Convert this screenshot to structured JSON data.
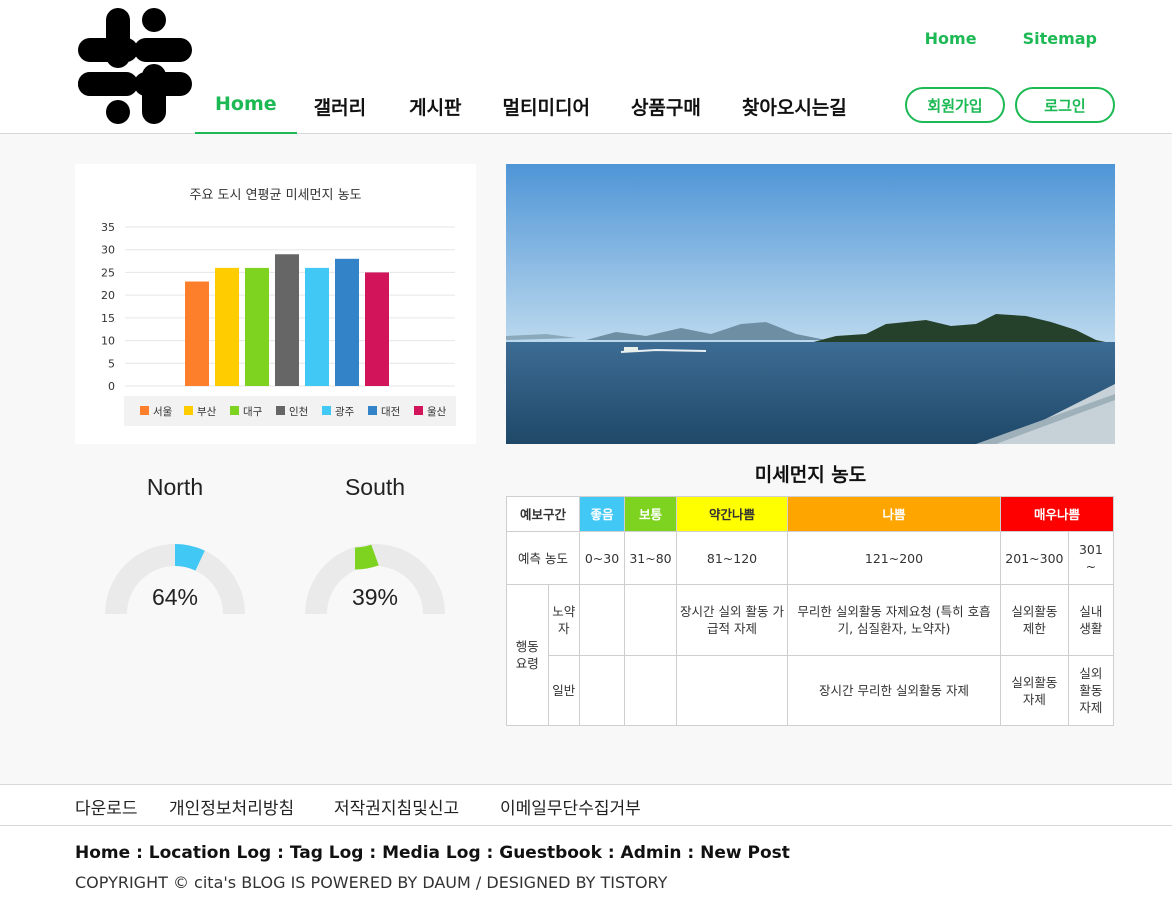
{
  "header": {
    "logo_icon": "slack-style-logo-icon",
    "top_links": [
      "Home",
      "Sitemap"
    ],
    "nav": [
      "Home",
      "갤러리",
      "게시판",
      "멀티미디어",
      "상품구매",
      "찾아오시는길"
    ],
    "active_nav": "Home",
    "join_label": "회원가입",
    "login_label": "로그인",
    "accent_color": "#1db954"
  },
  "chart_data": {
    "type": "bar",
    "title": "주요 도시 연평균 미세먼지 농도",
    "categories": [
      "서울",
      "부산",
      "대구",
      "인천",
      "광주",
      "대전",
      "울산"
    ],
    "values": [
      23,
      26,
      26,
      29,
      26,
      28,
      25
    ],
    "colors": [
      "#fd7f2c",
      "#ffcc00",
      "#7ed321",
      "#666666",
      "#41c8f5",
      "#3283c8",
      "#d2145a"
    ],
    "ylim": [
      0,
      35
    ],
    "yticks": [
      0,
      5,
      10,
      15,
      20,
      25,
      30,
      35
    ],
    "grid": true,
    "legend": "bottom"
  },
  "gauges": [
    {
      "title": "North",
      "value": 64,
      "label": "64%",
      "color": "#41c8f5"
    },
    {
      "title": "South",
      "value": 39,
      "label": "39%",
      "color": "#7ed321"
    }
  ],
  "dust_table": {
    "title": "미세먼지 농도",
    "header": {
      "label": "예보구간",
      "levels": [
        {
          "name": "좋음",
          "bg": "#41c8f5"
        },
        {
          "name": "보통",
          "bg": "#7ed321"
        },
        {
          "name": "약간나쁨",
          "bg": "#ffff00"
        },
        {
          "name": "나쁨",
          "bg": "#ffa500"
        },
        {
          "name": "매우나쁨",
          "bg": "#ff0000"
        }
      ]
    },
    "predict_row": {
      "label": "예측 농도",
      "values": [
        "0~30",
        "31~80",
        "81~120",
        "121~200",
        "201~300",
        "301 ~"
      ]
    },
    "action_label": "행동 요령",
    "elder_row": {
      "label": "노약자",
      "values": [
        "",
        "",
        "장시간 실외 활동 가급적 자제",
        "무리한 실외활동 자제요청 (특히 호흡기, 심질환자, 노약자)",
        "실외활동 제한",
        "실내 생활"
      ]
    },
    "general_row": {
      "label": "일반",
      "values": [
        "",
        "",
        "",
        "장시간 무리한 실외활동 자제",
        "실외활동 자제",
        "실외 활동 자제"
      ]
    }
  },
  "footer": {
    "links": [
      "다운로드",
      "개인정보처리방침",
      "저작권지침및신고",
      "이메일무단수집거부"
    ],
    "nav_line": "Home : Location Log : Tag Log : Media Log : Guestbook : Admin : New Post",
    "copyright": "COPYRIGHT © cita's BLOG IS POWERED BY DAUM / DESIGNED BY TISTORY"
  }
}
